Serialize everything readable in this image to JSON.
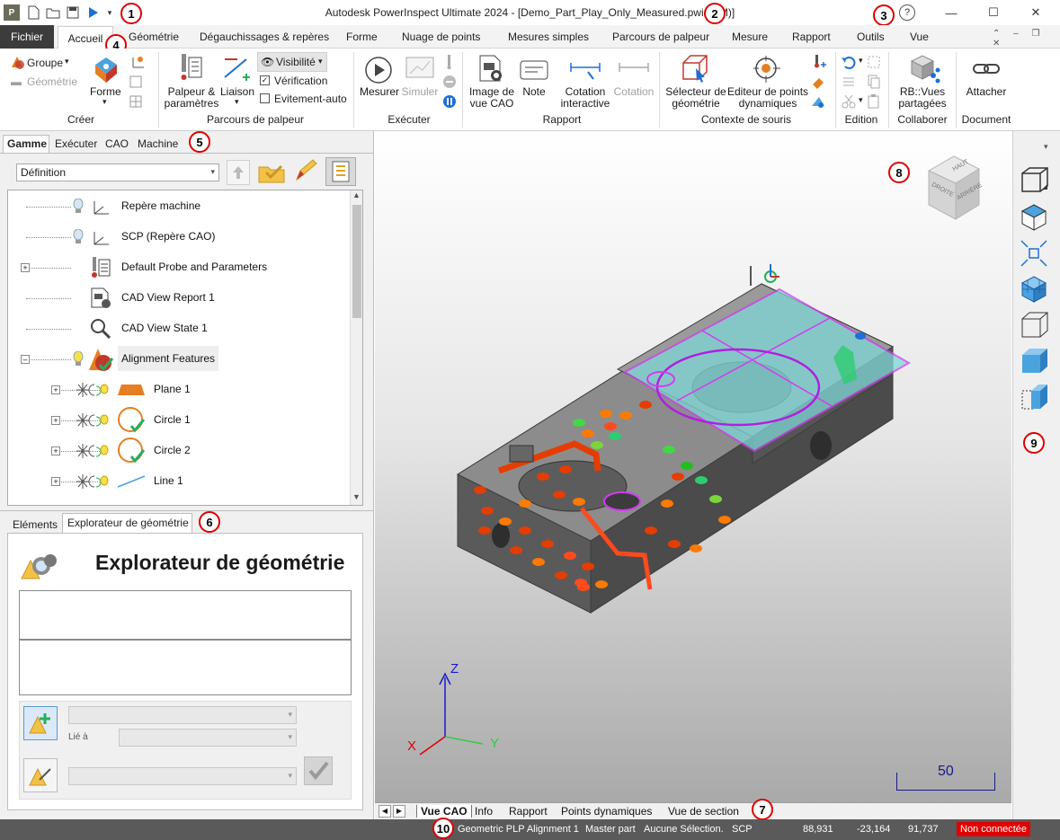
{
  "app": {
    "title": "Autodesk PowerInspect Ultimate 2024 - [Demo_Part_Play_Only_Measured.pwi (MM)]"
  },
  "callouts": [
    "1",
    "2",
    "3",
    "4",
    "5",
    "6",
    "7",
    "8",
    "9",
    "10"
  ],
  "quick_access": [
    "app-logo-icon",
    "new-file-icon",
    "open-folder-icon",
    "save-icon",
    "play-icon",
    "customize-dropdown-icon"
  ],
  "window_controls": {
    "help": "?",
    "minimize": "—",
    "maximize": "☐",
    "close": "✕"
  },
  "ribbon": {
    "file_tab": "Fichier",
    "tabs": [
      "Accueil",
      "Géométrie",
      "Dégauchissages & repères",
      "Forme",
      "Nuage de points",
      "Mesures simples",
      "Parcours de palpeur",
      "Mesure",
      "Rapport",
      "Outils",
      "Vue"
    ],
    "active_tab": "Accueil",
    "groups": {
      "creer": {
        "label": "Créer",
        "groupe": "Groupe",
        "geometrie": "Géométrie",
        "forme": "Forme"
      },
      "parcours": {
        "label": "Parcours de palpeur",
        "palpeur": "Palpeur &\nparamètres",
        "liaison": "Liaison",
        "visibilite": "Visibilité",
        "verification": "Vérification",
        "evitement": "Evitement-auto"
      },
      "executer": {
        "label": "Exécuter",
        "mesurer": "Mesurer",
        "simuler": "Simuler"
      },
      "rapport": {
        "label": "Rapport",
        "image": "Image de\nvue CAO",
        "note": "Note",
        "cotation_interactive": "Cotation\ninteractive",
        "cotation": "Cotation"
      },
      "contexte": {
        "label": "Contexte de souris",
        "selecteur": "Sélecteur de\ngéométrie",
        "editeur": "Editeur de points\ndynamiques"
      },
      "edition": {
        "label": "Edition"
      },
      "collaborer": {
        "label": "Collaborer",
        "vues": "RB::Vues\npartagées"
      },
      "document": {
        "label": "Document",
        "attacher": "Attacher"
      }
    }
  },
  "left_panel": {
    "top_tabs": [
      "Gamme",
      "Exécuter",
      "CAO",
      "Machine"
    ],
    "active_top_tab": "Gamme",
    "dropdown_value": "Définition",
    "tree": [
      {
        "label": "Repère machine",
        "icon": "axis-icon"
      },
      {
        "label": "SCP (Repère CAO)",
        "icon": "axis-icon"
      },
      {
        "label": "Default Probe and Parameters",
        "icon": "probe-icon"
      },
      {
        "label": "CAD View Report 1",
        "icon": "report-icon"
      },
      {
        "label": "CAD View State 1",
        "icon": "magnifier-icon"
      },
      {
        "label": "Alignment Features",
        "icon": "alignment-icon"
      },
      {
        "label": "Plane 1",
        "icon": "plane-icon"
      },
      {
        "label": "Circle 1",
        "icon": "circle-icon"
      },
      {
        "label": "Circle 2",
        "icon": "circle-icon"
      },
      {
        "label": "Line 1",
        "icon": "line-icon"
      }
    ],
    "bottom_tabs": [
      "Eléments",
      "Explorateur de géométrie"
    ],
    "active_bottom_tab": "Explorateur de géométrie",
    "explorer_title": "Explorateur de géométrie",
    "lie_a": "Lié à"
  },
  "viewport": {
    "view_cube": {
      "top": "HAUT",
      "front": "DROITE",
      "right": "ARRIÈRE"
    },
    "axes": {
      "x": "X",
      "y": "Y",
      "z": "Z"
    },
    "scale": "50",
    "view_tabs": [
      "Vue CAO",
      "Info",
      "Rapport",
      "Points dynamiques",
      "Vue de section"
    ],
    "active_view_tab": "Vue CAO"
  },
  "right_toolbar": [
    "iso-view-icon",
    "top-view-icon",
    "zoom-fit-icon",
    "shaded-cube-icon",
    "wireframe-cube-icon",
    "solid-cube-icon",
    "section-cube-icon"
  ],
  "status": {
    "alignment": "Geometric PLP Alignment 1",
    "part": "Master part",
    "selection": "Aucune Sélection.",
    "csys": "SCP",
    "x": "88,931",
    "y": "-23,164",
    "z": "91,737",
    "connection": "Non connectée"
  },
  "colors": {
    "accent_red": "#e00000",
    "model_gray": "#6e6e6e",
    "plane_cyan": "#7fd6d6",
    "highlight_magenta": "#d23cf0"
  }
}
